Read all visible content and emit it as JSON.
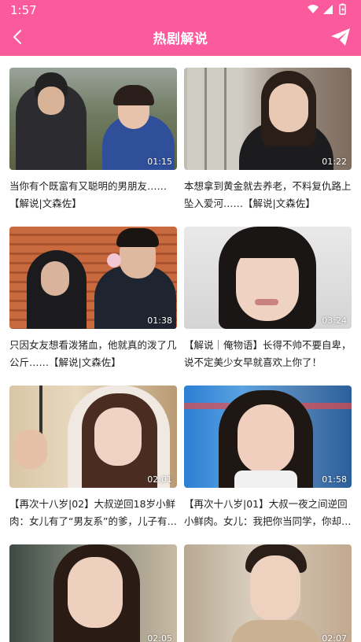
{
  "status_bar": {
    "time": "1:57"
  },
  "header": {
    "title": "热剧解说",
    "back_icon": "chevron-left-icon",
    "send_icon": "paper-plane-icon"
  },
  "colors": {
    "accent": "#fb5a9c"
  },
  "videos": [
    {
      "duration": "01:15",
      "title": "当你有个既富有又聪明的男朋友……【解说|文森佐】"
    },
    {
      "duration": "01:22",
      "title": "本想拿到黄金就去养老，不料复仇路上坠入爱河……【解说|文森佐】"
    },
    {
      "duration": "01:38",
      "title": "只因女友想看泼猪血，他就真的泼了几公斤……【解说|文森佐】"
    },
    {
      "duration": "03:24",
      "title": "【解说｜俺物语】长得不帅不要自卑，说不定美少女早就喜欢上你了！"
    },
    {
      "duration": "02:01",
      "title": "【再次十八岁|02】大叔逆回18岁小鲜肉：女儿有了“男友系”的爹，儿子有…"
    },
    {
      "duration": "01:58",
      "title": "【再次十八岁|01】大叔一夜之间逆回小鲜肉。女儿：我把你当同学，你却…"
    },
    {
      "duration": "02:05",
      "title": ""
    },
    {
      "duration": "02:07",
      "title": ""
    }
  ]
}
